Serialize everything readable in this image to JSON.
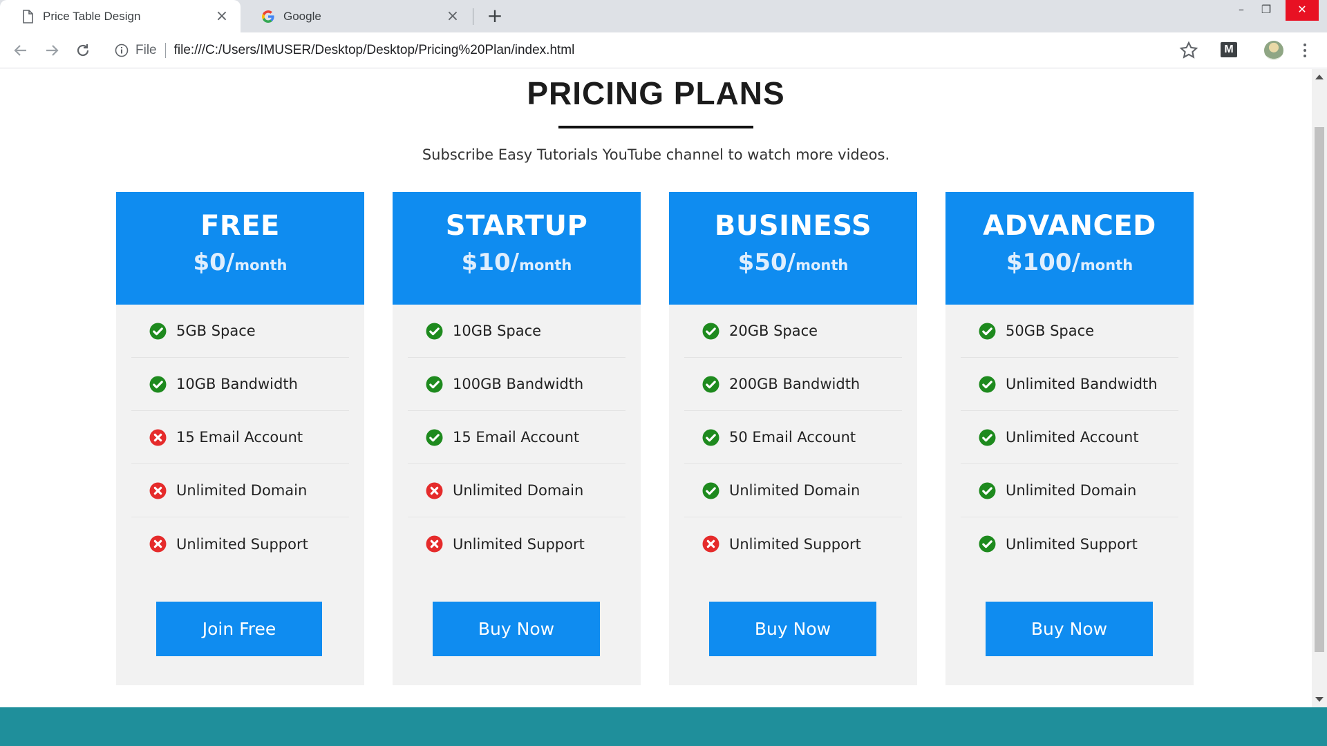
{
  "browser": {
    "tabs": [
      {
        "title": "Price Table Design",
        "active": true,
        "icon": "page-icon"
      },
      {
        "title": "Google",
        "active": false,
        "icon": "google-icon"
      }
    ],
    "new_tab_label": "+",
    "url_scheme": "File",
    "url": "file:///C:/Users/IMUSER/Desktop/Desktop/Pricing%20Plan/index.html",
    "extension_label": "M"
  },
  "page": {
    "heading": "PRICING PLANS",
    "subtitle": "Subscribe Easy Tutorials YouTube channel to watch more videos.",
    "colors": {
      "accent": "#0f8cf0",
      "check": "#1e8a1e",
      "cross": "#e52b2b",
      "footer": "#1f8f9b"
    },
    "plans": [
      {
        "name": "FREE",
        "price": "$0/",
        "period": "month",
        "button": "Join Free",
        "features": [
          {
            "label": "5GB Space",
            "included": true
          },
          {
            "label": "10GB Bandwidth",
            "included": true
          },
          {
            "label": "15 Email Account",
            "included": false
          },
          {
            "label": "Unlimited Domain",
            "included": false
          },
          {
            "label": "Unlimited Support",
            "included": false
          }
        ]
      },
      {
        "name": "STARTUP",
        "price": "$10/",
        "period": "month",
        "button": "Buy Now",
        "features": [
          {
            "label": "10GB Space",
            "included": true
          },
          {
            "label": "100GB Bandwidth",
            "included": true
          },
          {
            "label": "15 Email Account",
            "included": true
          },
          {
            "label": "Unlimited Domain",
            "included": false
          },
          {
            "label": "Unlimited Support",
            "included": false
          }
        ]
      },
      {
        "name": "BUSINESS",
        "price": "$50/",
        "period": "month",
        "button": "Buy Now",
        "features": [
          {
            "label": "20GB Space",
            "included": true
          },
          {
            "label": "200GB Bandwidth",
            "included": true
          },
          {
            "label": "50 Email Account",
            "included": true
          },
          {
            "label": "Unlimited Domain",
            "included": true
          },
          {
            "label": "Unlimited Support",
            "included": false
          }
        ]
      },
      {
        "name": "ADVANCED",
        "price": "$100/",
        "period": "month",
        "button": "Buy Now",
        "features": [
          {
            "label": "50GB Space",
            "included": true
          },
          {
            "label": "Unlimited Bandwidth",
            "included": true
          },
          {
            "label": "Unlimited Account",
            "included": true
          },
          {
            "label": "Unlimited Domain",
            "included": true
          },
          {
            "label": "Unlimited Support",
            "included": true
          }
        ]
      }
    ]
  }
}
